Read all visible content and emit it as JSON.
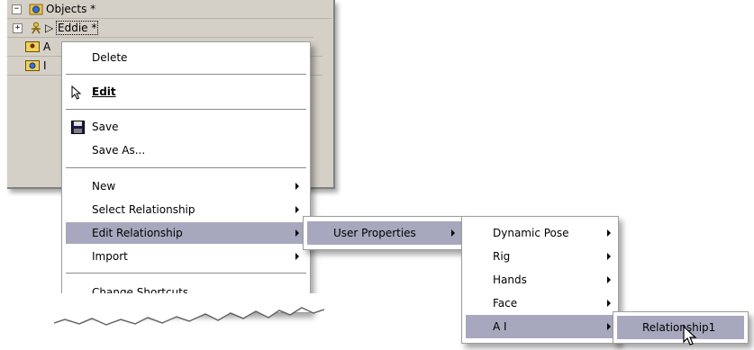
{
  "tree": {
    "root_expander": "−",
    "root_label": "Objects *",
    "child_expander": "+",
    "child_marker": "▷",
    "child_label": "Eddie *",
    "row3_partial": "A",
    "row4_partial": "I"
  },
  "context_menu": {
    "items": [
      {
        "label": "Delete"
      },
      {
        "label": "Edit",
        "bold": true,
        "icon": "pointer-icon"
      },
      {
        "label": "Save",
        "icon": "floppy-disk-icon"
      },
      {
        "label": "Save As..."
      },
      {
        "label": "New",
        "submenu": true
      },
      {
        "label": "Select Relationship",
        "submenu": true
      },
      {
        "label": "Edit Relationship",
        "submenu": true,
        "highlighted": true
      },
      {
        "label": "Import",
        "submenu": true
      },
      {
        "label": "Change Shortcuts..."
      }
    ]
  },
  "submenu_edit_relationship": {
    "items": [
      {
        "label": "User Properties",
        "submenu": true,
        "highlighted": true
      }
    ]
  },
  "submenu_user_properties": {
    "items": [
      {
        "label": "Dynamic Pose",
        "submenu": true
      },
      {
        "label": "Rig",
        "submenu": true
      },
      {
        "label": "Hands",
        "submenu": true
      },
      {
        "label": "Face",
        "submenu": true
      },
      {
        "label": "A I",
        "submenu": true,
        "highlighted": true
      }
    ]
  },
  "submenu_ai": {
    "items": [
      {
        "label": "Relationship1",
        "highlighted": true
      }
    ]
  },
  "colors": {
    "panel_bg": "#d4d0c8",
    "highlight_bg": "#a7a8be",
    "menu_bg": "#ffffff"
  }
}
